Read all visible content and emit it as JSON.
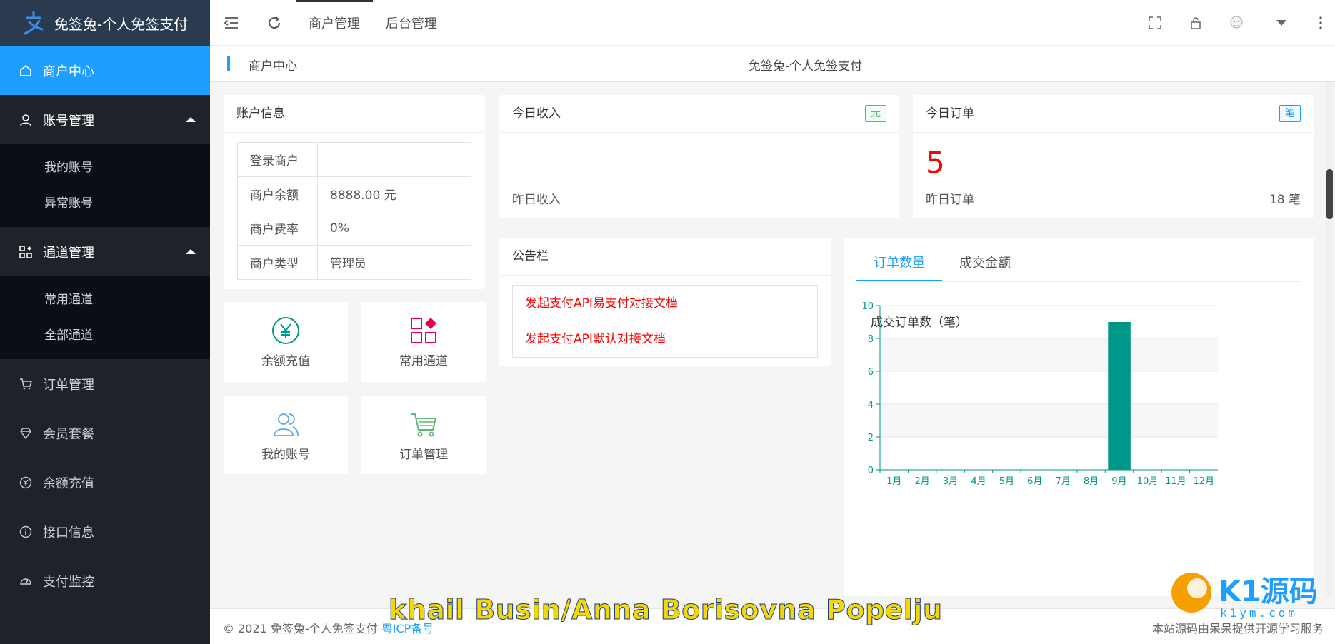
{
  "app": {
    "title": "免签兔-个人免签支付"
  },
  "sidebar": {
    "items": [
      {
        "label": "商户中心",
        "icon": "home-icon"
      },
      {
        "label": "账号管理",
        "icon": "user-icon",
        "children": [
          "我的账号",
          "异常账号"
        ]
      },
      {
        "label": "通道管理",
        "icon": "grid-icon",
        "children": [
          "常用通道",
          "全部通道"
        ]
      },
      {
        "label": "订单管理",
        "icon": "cart-icon"
      },
      {
        "label": "会员套餐",
        "icon": "diamond-icon"
      },
      {
        "label": "余额充值",
        "icon": "yen-icon"
      },
      {
        "label": "接口信息",
        "icon": "info-icon"
      },
      {
        "label": "支付监控",
        "icon": "dashboard-icon"
      }
    ]
  },
  "header": {
    "tabs": [
      "商户管理",
      "后台管理"
    ],
    "active_tab": "商户管理"
  },
  "titlebar": {
    "left": "商户中心",
    "center": "免签兔-个人免签支付"
  },
  "account": {
    "title": "账户信息",
    "rows": [
      {
        "label": "登录商户",
        "value": ""
      },
      {
        "label": "商户余额",
        "value": "8888.00 元"
      },
      {
        "label": "商户费率",
        "value": "0%"
      },
      {
        "label": "商户类型",
        "value": "管理员"
      }
    ]
  },
  "tiles": [
    {
      "label": "余额充值",
      "icon": "yen-circle-icon"
    },
    {
      "label": "常用通道",
      "icon": "channel-grid-icon"
    },
    {
      "label": "我的账号",
      "icon": "users-icon"
    },
    {
      "label": "订单管理",
      "icon": "cart-icon"
    }
  ],
  "income": {
    "title": "今日收入",
    "badge": "元",
    "yesterday_label": "昨日收入",
    "yesterday_value": ""
  },
  "orders": {
    "title": "今日订单",
    "badge": "笔",
    "today": "5",
    "yesterday_label": "昨日订单",
    "yesterday_value": "18 笔"
  },
  "notice": {
    "title": "公告栏",
    "links": [
      "发起支付API易支付对接文档",
      "发起支付API默认对接文档"
    ]
  },
  "chart_tabs": [
    "订单数量",
    "成交金额"
  ],
  "chart_data": {
    "type": "bar",
    "title": "成交订单数（笔）",
    "categories": [
      "1月",
      "2月",
      "3月",
      "4月",
      "5月",
      "6月",
      "7月",
      "8月",
      "9月",
      "10月",
      "11月",
      "12月"
    ],
    "values": [
      0,
      0,
      0,
      0,
      0,
      0,
      0,
      0,
      9,
      0,
      0,
      0
    ],
    "ylim": [
      0,
      10
    ],
    "yticks": [
      "0",
      "2",
      "4",
      "6",
      "8",
      "10"
    ],
    "bar_color": "#009688",
    "grid": true
  },
  "footer": {
    "left": "© 2021 免签兔-个人免签支付",
    "link": "粤ICP备号",
    "right": "本站源码由呆呆提供开源学习服务"
  },
  "overlay": {
    "text": "khail Busin/Anna Borisovna Popelju"
  },
  "watermark": {
    "text": "K1源码",
    "sub": "k1ym.com"
  },
  "colors": {
    "accent": "#1e9fff",
    "sidebar": "#20222a",
    "bar": "#009688"
  }
}
